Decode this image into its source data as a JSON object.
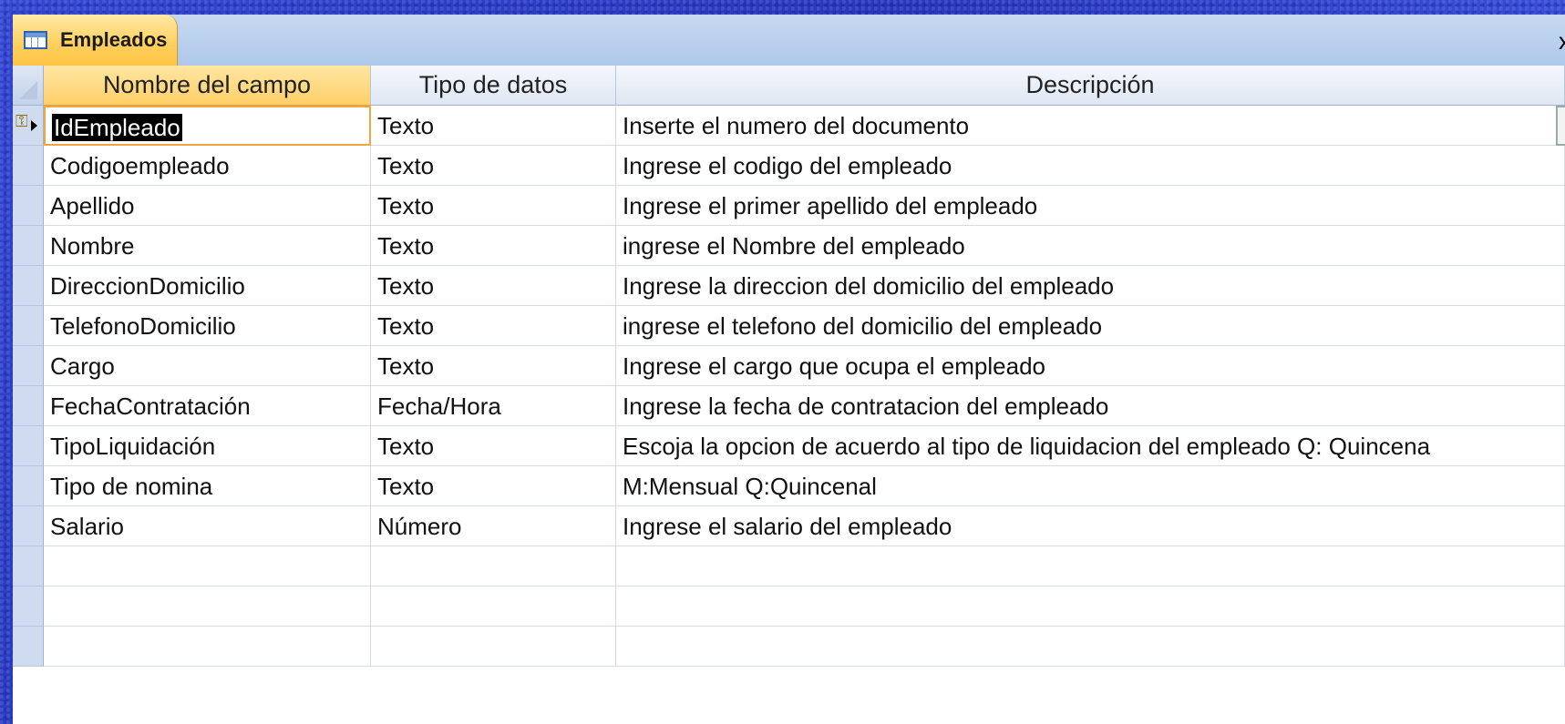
{
  "tab": {
    "title": "Empleados",
    "close": "x"
  },
  "columns": {
    "name": "Nombre del campo",
    "type": "Tipo de datos",
    "description": "Descripción"
  },
  "rows": [
    {
      "name": "IdEmpleado",
      "type": "Texto",
      "description": "Inserte el numero del documento",
      "primary_key": true
    },
    {
      "name": "Codigoempleado",
      "type": "Texto",
      "description": "Ingrese el codigo del empleado"
    },
    {
      "name": "Apellido",
      "type": "Texto",
      "description": "Ingrese el primer apellido del empleado"
    },
    {
      "name": "Nombre",
      "type": "Texto",
      "description": "ingrese el Nombre del empleado"
    },
    {
      "name": "DireccionDomicilio",
      "type": "Texto",
      "description": "Ingrese la direccion del domicilio del empleado"
    },
    {
      "name": "TelefonoDomicilio",
      "type": "Texto",
      "description": "ingrese el telefono del domicilio del empleado"
    },
    {
      "name": "Cargo",
      "type": "Texto",
      "description": "Ingrese el cargo que ocupa el empleado"
    },
    {
      "name": "FechaContratación",
      "type": "Fecha/Hora",
      "description": "Ingrese la fecha de contratacion del empleado"
    },
    {
      "name": "TipoLiquidación",
      "type": "Texto",
      "description": "Escoja la opcion de acuerdo al tipo de liquidacion del empleado Q: Quincena"
    },
    {
      "name": "Tipo de nomina",
      "type": "Texto",
      "description": "M:Mensual   Q:Quincenal"
    },
    {
      "name": "Salario",
      "type": "Número",
      "description": "Ingrese el salario del empleado"
    },
    {
      "name": "",
      "type": "",
      "description": ""
    },
    {
      "name": "",
      "type": "",
      "description": ""
    },
    {
      "name": "",
      "type": "",
      "description": ""
    }
  ],
  "icons": {
    "tab": "table-icon",
    "key": "primary-key-icon",
    "current_row": "current-row-arrow-icon"
  },
  "colors": {
    "background": "#2f3fc4",
    "active_header": "#ffcf68",
    "active_border": "#f0a63c"
  }
}
